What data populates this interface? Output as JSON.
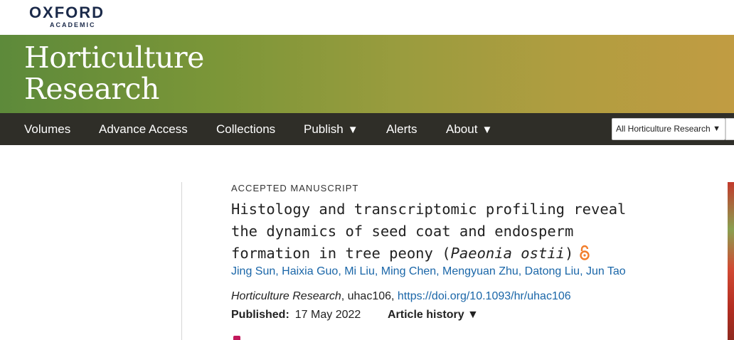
{
  "publisher": {
    "name": "OXFORD",
    "sub": "ACADEMIC"
  },
  "journal": {
    "title_line1": "Horticulture",
    "title_line2": "Research"
  },
  "nav": {
    "items": [
      {
        "label": "Volumes",
        "has_caret": false
      },
      {
        "label": "Advance Access",
        "has_caret": false
      },
      {
        "label": "Collections",
        "has_caret": false
      },
      {
        "label": "Publish",
        "has_caret": true
      },
      {
        "label": "Alerts",
        "has_caret": false
      },
      {
        "label": "About",
        "has_caret": true
      }
    ],
    "caret": "▼",
    "search_scope": "All Horticulture Research"
  },
  "article": {
    "type": "ACCEPTED MANUSCRIPT",
    "title_main": "Histology and transcriptomic profiling reveal the dynamics of seed coat and endosperm formation in tree peony (",
    "title_species": "Paeonia ostii",
    "title_end": ")",
    "open_access_icon": "open-access-lock-icon",
    "authors": [
      "Jing Sun",
      "Haixia Guo",
      "Mi Liu",
      "Ming Chen",
      "Mengyuan Zhu",
      "Datong Liu",
      "Jun Tao"
    ],
    "author_separator": ",",
    "citation": {
      "journal": "Horticulture Research",
      "article_id": ", uhac106, ",
      "doi": "https://doi.org/10.1093/hr/uhac106"
    },
    "published_label": "Published:",
    "published_date": "17 May 2022",
    "history_label": "Article history ▼"
  },
  "colors": {
    "nav_bg": "#2f2e28",
    "link": "#1a66a8",
    "banner_start": "#5d8a3a",
    "banner_end": "#c19c42",
    "open_access": "#f27d2b"
  }
}
